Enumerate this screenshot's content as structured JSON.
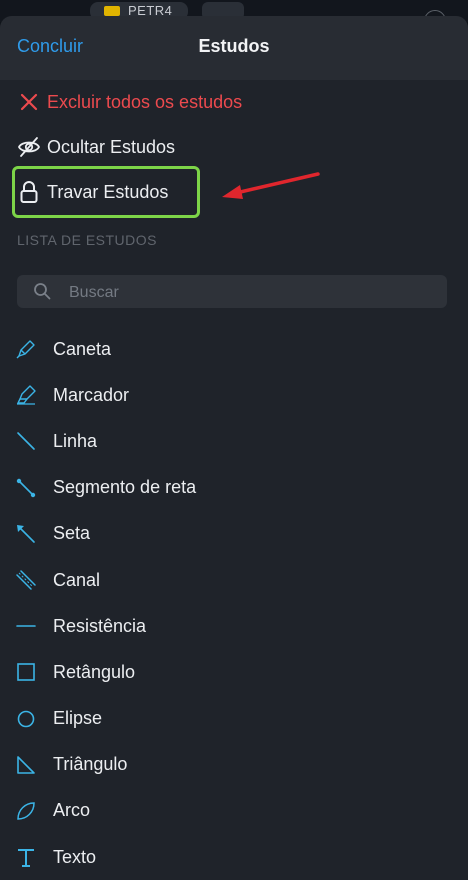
{
  "status_bar": {
    "ticker": "PETR4"
  },
  "sheet": {
    "title": "Estudos",
    "done_label": "Concluir"
  },
  "actions": {
    "delete_all": "Excluir todos os estudos",
    "hide": "Ocultar Estudos",
    "lock": "Travar Estudos"
  },
  "list": {
    "section_title": "LISTA DE ESTUDOS",
    "search_placeholder": "Buscar",
    "tools": [
      {
        "label": "Caneta",
        "icon": "pen-icon"
      },
      {
        "label": "Marcador",
        "icon": "marker-icon"
      },
      {
        "label": "Linha",
        "icon": "line-icon"
      },
      {
        "label": "Segmento de reta",
        "icon": "segment-icon"
      },
      {
        "label": "Seta",
        "icon": "arrow-icon"
      },
      {
        "label": "Canal",
        "icon": "channel-icon"
      },
      {
        "label": "Resistência",
        "icon": "resistance-icon"
      },
      {
        "label": "Retângulo",
        "icon": "rectangle-icon"
      },
      {
        "label": "Elipse",
        "icon": "ellipse-icon"
      },
      {
        "label": "Triângulo",
        "icon": "triangle-icon"
      },
      {
        "label": "Arco",
        "icon": "arc-icon"
      },
      {
        "label": "Texto",
        "icon": "text-icon"
      }
    ]
  },
  "colors": {
    "accent": "#2f9bea",
    "danger": "#ec4a4e",
    "tool_icon": "#3bb4e6",
    "highlight": "#7dd448",
    "annotation_arrow": "#e0262d"
  }
}
